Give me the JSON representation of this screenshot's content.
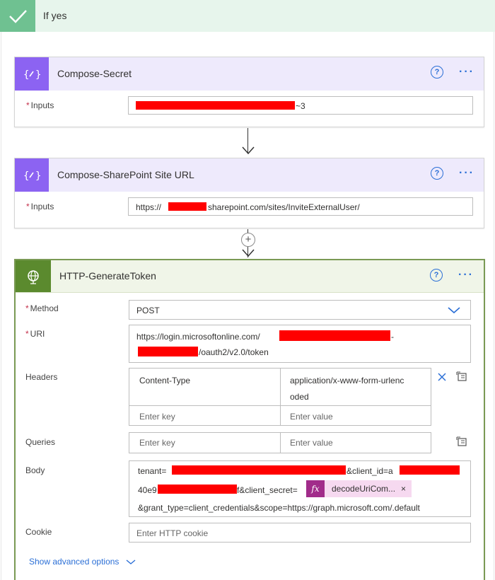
{
  "condition": {
    "title": "If yes"
  },
  "compose_secret": {
    "title": "Compose-Secret",
    "inputs_label": "Inputs",
    "inputs_suffix": "~3"
  },
  "compose_site": {
    "title": "Compose-SharePoint Site URL",
    "inputs_label": "Inputs",
    "url_prefix": "https://",
    "url_suffix": "sharepoint.com/sites/InviteExternalUser/"
  },
  "add_step": {
    "symbol": "+"
  },
  "http": {
    "title": "HTTP-GenerateToken",
    "method_label": "Method",
    "method_value": "POST",
    "uri_label": "URI",
    "uri_line1": "https://login.microsoftonline.com/",
    "uri_line1_suffix": "-",
    "uri_line2_suffix": "/oauth2/v2.0/token",
    "headers_label": "Headers",
    "header_key": "Content-Type",
    "header_value_line1": "application/x-www-form-urlenc",
    "header_value_line2": "oded",
    "key_placeholder": "Enter key",
    "value_placeholder": "Enter value",
    "queries_label": "Queries",
    "body_label": "Body",
    "body_line1_start": "tenant=",
    "body_line1_mid": "&client_id=a",
    "body_line2_start": "40e9",
    "body_line2_mid": "f&client_secret=",
    "body_chip_fx": "fx",
    "body_chip_text": "decodeUriCom...",
    "body_chip_close": "×",
    "body_line3": "&grant_type=client_credentials&scope=https://graph.microsoft.com/.default",
    "cookie_label": "Cookie",
    "cookie_placeholder": "Enter HTTP cookie",
    "advanced_link": "Show advanced options"
  },
  "icons": {
    "check": "check-icon",
    "compose": "compose-icon",
    "globe": "globe-icon",
    "help": "help-icon",
    "more": "more-icon",
    "chevron": "chevron-down-icon",
    "clear": "close-icon",
    "switch_mode": "switch-mode-icon"
  }
}
